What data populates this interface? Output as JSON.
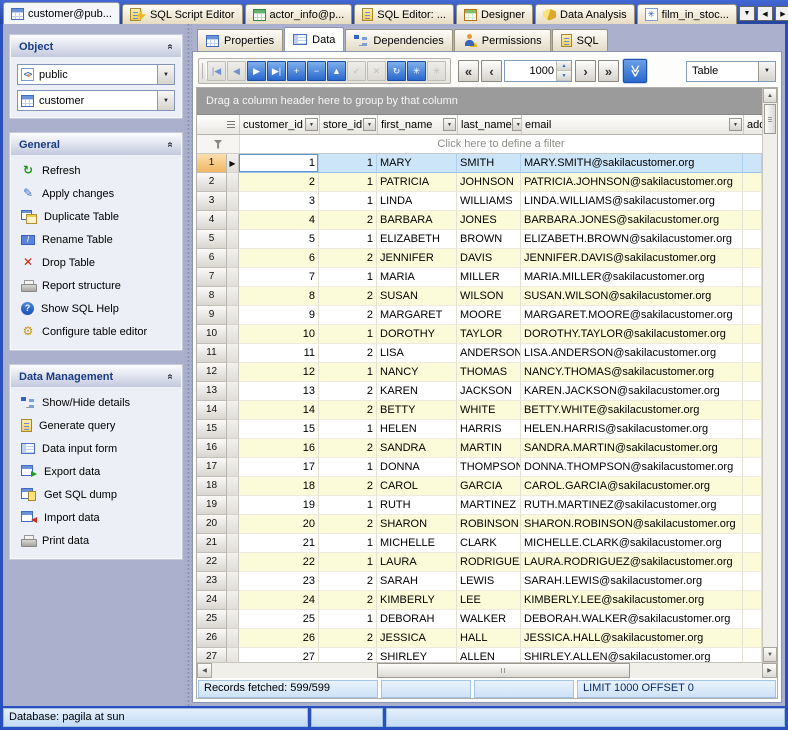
{
  "icons": {
    "row_marker": "▶",
    "collapse_chevron": "«",
    "dropdown_arrow": "▼",
    "up_arrow": "▲",
    "down_arrow": "▼",
    "left_arrow": "◀",
    "right_arrow": "▶",
    "func_glyph": "✳",
    "help_glyph": "?",
    "pen_glyph": "✎",
    "drop_glyph": "✕",
    "refresh_glyph": "↻",
    "gear_glyph": "⚙",
    "schema_glyph": "<>",
    "fetch_all_glyph": "≫",
    "rename_glyph": "I"
  },
  "colors": {
    "chrome_blue": "#2a4fc0",
    "sidebar_lavender": "#abb1cc",
    "selected_row": "#cde5f9",
    "alt_row_yellow": "#fbfbda",
    "toolbar_button_blue": "#2a68cc",
    "status_bar_blue": "#cde2f7"
  },
  "window": {
    "doc_tabs": [
      {
        "label": "customer@pub..."
      },
      {
        "label": "SQL Script Editor"
      },
      {
        "label": "actor_info@p..."
      },
      {
        "label": "SQL Editor: ..."
      },
      {
        "label": "Designer"
      },
      {
        "label": "Data Analysis"
      },
      {
        "label": "film_in_stoc..."
      }
    ],
    "tab_controls": [
      {
        "name": "tab-list-button",
        "glyph": "▼"
      },
      {
        "name": "scroll-tabs-left-button",
        "glyph": "◀"
      },
      {
        "name": "scroll-tabs-right-button",
        "glyph": "▶"
      },
      {
        "name": "close-tab-button",
        "glyph": "✕"
      }
    ]
  },
  "sidebar": {
    "object_panel": {
      "title": "Object",
      "schema_value": "public",
      "table_value": "customer"
    },
    "general_panel": {
      "title": "General",
      "items": [
        {
          "label": "Refresh"
        },
        {
          "label": "Apply changes"
        },
        {
          "label": "Duplicate Table"
        },
        {
          "label": "Rename Table"
        },
        {
          "label": "Drop Table"
        },
        {
          "label": "Report structure"
        },
        {
          "label": "Show SQL Help"
        },
        {
          "label": "Configure table editor"
        }
      ]
    },
    "data_panel": {
      "title": "Data Management",
      "items": [
        {
          "label": "Show/Hide details"
        },
        {
          "label": "Generate query"
        },
        {
          "label": "Data input form"
        },
        {
          "label": "Export data"
        },
        {
          "label": "Get SQL dump"
        },
        {
          "label": "Import data"
        },
        {
          "label": "Print data"
        }
      ]
    }
  },
  "content": {
    "tabs": [
      {
        "label": "Properties"
      },
      {
        "label": "Data"
      },
      {
        "label": "Dependencies"
      },
      {
        "label": "Permissions"
      },
      {
        "label": "SQL"
      }
    ],
    "toolbar": {
      "record_buttons": [
        {
          "name": "first-record-button",
          "glyph": "|◀",
          "style": "dim"
        },
        {
          "name": "prior-record-button",
          "glyph": "◀",
          "style": "dim"
        },
        {
          "name": "next-record-button",
          "glyph": "▶",
          "style": "blue"
        },
        {
          "name": "last-record-button",
          "glyph": "▶|",
          "style": "blue"
        },
        {
          "name": "insert-record-button",
          "glyph": "+",
          "style": "blue"
        },
        {
          "name": "delete-record-button",
          "glyph": "−",
          "style": "blue"
        },
        {
          "name": "edit-record-button",
          "glyph": "▲",
          "style": "blue"
        },
        {
          "name": "post-edit-button",
          "glyph": "✓",
          "style": "off"
        },
        {
          "name": "cancel-edit-button",
          "glyph": "✕",
          "style": "off"
        },
        {
          "name": "refresh-data-button",
          "glyph": "↻",
          "style": "blue"
        },
        {
          "name": "commit-transaction-button",
          "glyph": "✳",
          "style": "blue"
        },
        {
          "name": "rollback-transaction-button",
          "glyph": "✳",
          "style": "off"
        }
      ],
      "paging_left": [
        {
          "name": "first-page-button",
          "glyph": "«"
        },
        {
          "name": "prior-page-button",
          "glyph": "‹"
        }
      ],
      "rows_value": "1000",
      "paging_right": [
        {
          "name": "next-page-button",
          "glyph": "›"
        },
        {
          "name": "last-page-button",
          "glyph": "»"
        }
      ],
      "view_mode": "Table"
    },
    "grid": {
      "group_band": "Drag a column header here to group by that column",
      "filter_placeholder": "Click here to define a filter",
      "columns": [
        "customer_id",
        "store_id",
        "first_name",
        "last_name",
        "email",
        "add"
      ],
      "selected_row": 1,
      "rows": [
        [
          1,
          1,
          "MARY",
          "SMITH",
          "MARY.SMITH@sakilacustomer.org"
        ],
        [
          2,
          1,
          "PATRICIA",
          "JOHNSON",
          "PATRICIA.JOHNSON@sakilacustomer.org"
        ],
        [
          3,
          1,
          "LINDA",
          "WILLIAMS",
          "LINDA.WILLIAMS@sakilacustomer.org"
        ],
        [
          4,
          2,
          "BARBARA",
          "JONES",
          "BARBARA.JONES@sakilacustomer.org"
        ],
        [
          5,
          1,
          "ELIZABETH",
          "BROWN",
          "ELIZABETH.BROWN@sakilacustomer.org"
        ],
        [
          6,
          2,
          "JENNIFER",
          "DAVIS",
          "JENNIFER.DAVIS@sakilacustomer.org"
        ],
        [
          7,
          1,
          "MARIA",
          "MILLER",
          "MARIA.MILLER@sakilacustomer.org"
        ],
        [
          8,
          2,
          "SUSAN",
          "WILSON",
          "SUSAN.WILSON@sakilacustomer.org"
        ],
        [
          9,
          2,
          "MARGARET",
          "MOORE",
          "MARGARET.MOORE@sakilacustomer.org"
        ],
        [
          10,
          1,
          "DOROTHY",
          "TAYLOR",
          "DOROTHY.TAYLOR@sakilacustomer.org"
        ],
        [
          11,
          2,
          "LISA",
          "ANDERSON",
          "LISA.ANDERSON@sakilacustomer.org"
        ],
        [
          12,
          1,
          "NANCY",
          "THOMAS",
          "NANCY.THOMAS@sakilacustomer.org"
        ],
        [
          13,
          2,
          "KAREN",
          "JACKSON",
          "KAREN.JACKSON@sakilacustomer.org"
        ],
        [
          14,
          2,
          "BETTY",
          "WHITE",
          "BETTY.WHITE@sakilacustomer.org"
        ],
        [
          15,
          1,
          "HELEN",
          "HARRIS",
          "HELEN.HARRIS@sakilacustomer.org"
        ],
        [
          16,
          2,
          "SANDRA",
          "MARTIN",
          "SANDRA.MARTIN@sakilacustomer.org"
        ],
        [
          17,
          1,
          "DONNA",
          "THOMPSON",
          "DONNA.THOMPSON@sakilacustomer.org"
        ],
        [
          18,
          2,
          "CAROL",
          "GARCIA",
          "CAROL.GARCIA@sakilacustomer.org"
        ],
        [
          19,
          1,
          "RUTH",
          "MARTINEZ",
          "RUTH.MARTINEZ@sakilacustomer.org"
        ],
        [
          20,
          2,
          "SHARON",
          "ROBINSON",
          "SHARON.ROBINSON@sakilacustomer.org"
        ],
        [
          21,
          1,
          "MICHELLE",
          "CLARK",
          "MICHELLE.CLARK@sakilacustomer.org"
        ],
        [
          22,
          1,
          "LAURA",
          "RODRIGUEZ",
          "LAURA.RODRIGUEZ@sakilacustomer.org"
        ],
        [
          23,
          2,
          "SARAH",
          "LEWIS",
          "SARAH.LEWIS@sakilacustomer.org"
        ],
        [
          24,
          2,
          "KIMBERLY",
          "LEE",
          "KIMBERLY.LEE@sakilacustomer.org"
        ],
        [
          25,
          1,
          "DEBORAH",
          "WALKER",
          "DEBORAH.WALKER@sakilacustomer.org"
        ],
        [
          26,
          2,
          "JESSICA",
          "HALL",
          "JESSICA.HALL@sakilacustomer.org"
        ],
        [
          27,
          2,
          "SHIRLEY",
          "ALLEN",
          "SHIRLEY.ALLEN@sakilacustomer.org"
        ]
      ]
    },
    "status_segments": {
      "records": "Records fetched: 599/599",
      "limit": "LIMIT 1000 OFFSET 0"
    }
  },
  "app_status": {
    "database": "Database: pagila at sun"
  }
}
